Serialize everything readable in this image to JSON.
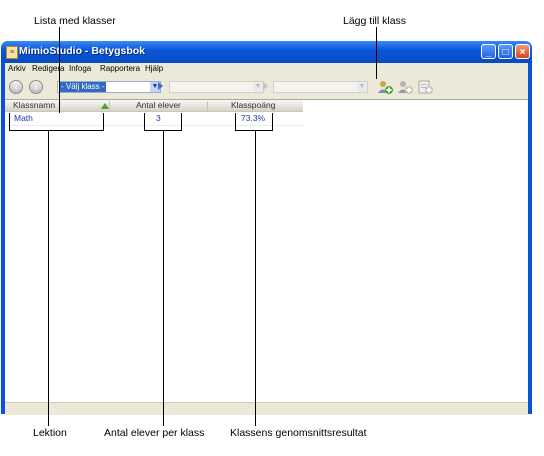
{
  "callouts": {
    "class_list": "Lista med klasser",
    "add_class": "Lägg till klass",
    "lesson": "Lektion",
    "student_count": "Antal elever per klass",
    "average": "Klassens genomsnittsresultat"
  },
  "window": {
    "title": "MimioStudio - Betygsbok",
    "controls": {
      "minimize": "_",
      "maximize": "□",
      "close": "×"
    }
  },
  "menu": [
    "Arkiv",
    "Redigera",
    "Infoga",
    "Rapportera",
    "Hjälp"
  ],
  "toolbar": {
    "class_select": "- Välj klass -",
    "icons": [
      "back-icon",
      "forward-icon",
      "add-class-icon",
      "add-student-icon",
      "add-lesson-icon"
    ]
  },
  "table": {
    "columns": [
      "Klassnamn",
      "Antal elever",
      "Klasspoäng"
    ],
    "rows": [
      {
        "name": "Math",
        "students": "3",
        "score": "73.3%"
      }
    ]
  },
  "colors": {
    "titlebar": "#0a58d8",
    "link_text": "#1c39a8",
    "sort_arrow": "#4aa02c"
  }
}
